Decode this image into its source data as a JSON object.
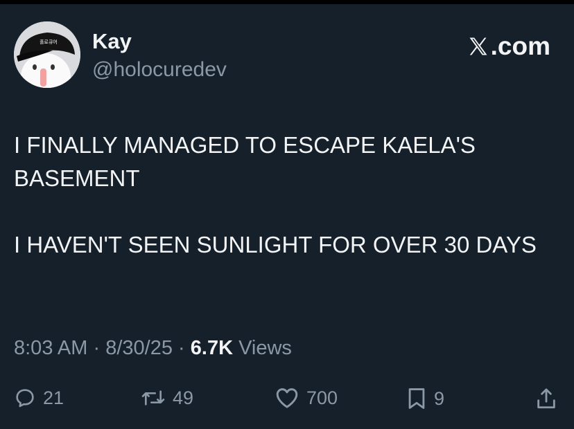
{
  "author": {
    "display_name": "Kay",
    "handle": "@holocuredev",
    "cap_text": "홀로큐어"
  },
  "brand": {
    "label": ".com"
  },
  "tweet": {
    "paragraphs": [
      "I FINALLY MANAGED TO ESCAPE KAELA'S BASEMENT",
      "I HAVEN'T SEEN SUNLIGHT FOR OVER 30 DAYS"
    ]
  },
  "meta": {
    "time": "8:03 AM",
    "separator": "·",
    "date": "8/30/25",
    "views_count": "6.7K",
    "views_label": "Views"
  },
  "actions": {
    "replies": "21",
    "reposts": "49",
    "likes": "700",
    "bookmarks": "9"
  },
  "colors": {
    "background": "#16202b",
    "text": "#f2f4f6",
    "secondary": "#8b98a5"
  }
}
